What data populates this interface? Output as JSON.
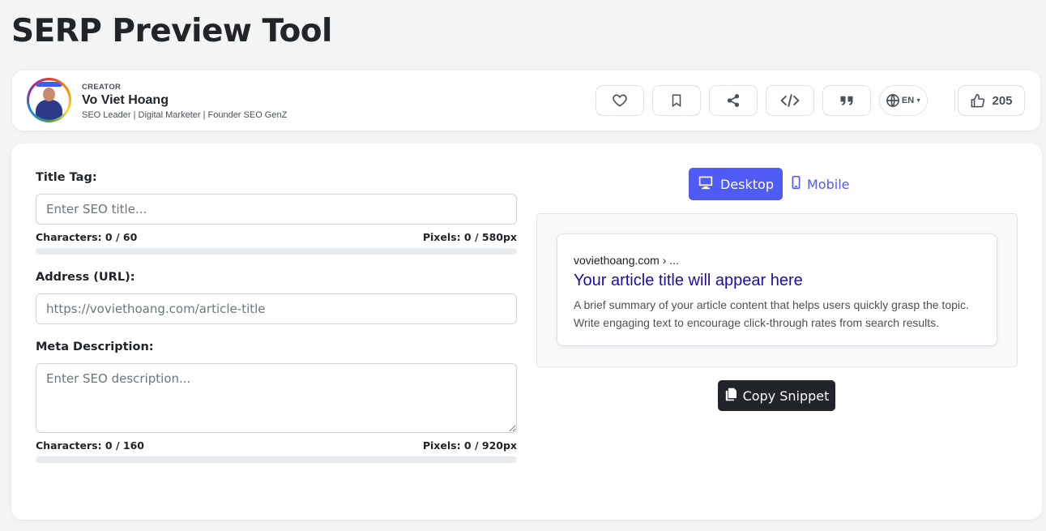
{
  "page": {
    "title": "SERP Preview Tool"
  },
  "creator": {
    "label": "CREATOR",
    "name": "Vo Viet Hoang",
    "bio": "SEO Leader | Digital Marketer | Founder SEO GenZ"
  },
  "actions": {
    "icons": [
      "heart-icon",
      "bookmark-icon",
      "share-icon",
      "code-icon",
      "quote-icon",
      "globe-icon"
    ],
    "language": "EN",
    "likes": "205"
  },
  "form": {
    "title": {
      "label": "Title Tag:",
      "placeholder": "Enter SEO title...",
      "characters": "Characters: 0 / 60",
      "pixels": "Pixels: 0 / 580px",
      "progress": 0
    },
    "url": {
      "label": "Address (URL):",
      "placeholder": "https://voviethoang.com/article-title"
    },
    "description": {
      "label": "Meta Description:",
      "placeholder": "Enter SEO description...",
      "characters": "Characters: 0 / 160",
      "pixels": "Pixels: 0 / 920px",
      "progress": 0
    }
  },
  "preview": {
    "tabs": {
      "desktop": "Desktop",
      "mobile": "Mobile"
    },
    "active_tab": "desktop",
    "url": "voviethoang.com › ...",
    "title": "Your article title will appear here",
    "description": "A brief summary of your article content that helps users quickly grasp the topic. Write engaging text to encourage click-through rates from search results.",
    "copy_label": "Copy Snippet"
  },
  "colors": {
    "accent": "#4f5bf5",
    "serp_title": "#1a0dab",
    "dark_button": "#212529"
  }
}
